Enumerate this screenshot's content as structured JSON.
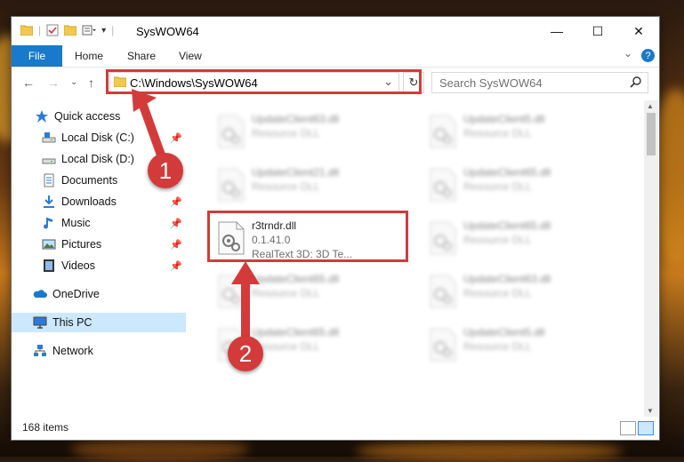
{
  "window": {
    "title": "SysWOW64",
    "buttons": {
      "minimize": "—",
      "maximize": "☐",
      "close": "✕"
    }
  },
  "ribbon": {
    "tabs": [
      "File",
      "Home",
      "Share",
      "View"
    ],
    "expand_glyph": "⌄",
    "help_glyph": "?"
  },
  "navigation": {
    "back": "←",
    "forward": "→",
    "recent": "⌄",
    "up": "↑"
  },
  "address": {
    "path": "C:\\Windows\\SysWOW64",
    "dropdown_glyph": "⌄",
    "refresh_glyph": "↻"
  },
  "search": {
    "placeholder": "Search SysWOW64"
  },
  "sidebar": {
    "items": [
      {
        "label": "Quick access",
        "icon": "star-icon",
        "pinned": false
      },
      {
        "label": "Local Disk (C:)",
        "icon": "drive-icon",
        "pinned": true
      },
      {
        "label": "Local Disk (D:)",
        "icon": "drive-icon",
        "pinned": false
      },
      {
        "label": "Documents",
        "icon": "documents-icon",
        "pinned": true
      },
      {
        "label": "Downloads",
        "icon": "downloads-icon",
        "pinned": true
      },
      {
        "label": "Music",
        "icon": "music-icon",
        "pinned": true
      },
      {
        "label": "Pictures",
        "icon": "pictures-icon",
        "pinned": true
      },
      {
        "label": "Videos",
        "icon": "videos-icon",
        "pinned": true
      },
      {
        "label": "OneDrive",
        "icon": "onedrive-icon",
        "pinned": false
      },
      {
        "label": "This PC",
        "icon": "pc-icon",
        "pinned": false
      },
      {
        "label": "Network",
        "icon": "network-icon",
        "pinned": false
      }
    ],
    "pin_glyph": "📌"
  },
  "files": [
    {
      "name": "UpdateClient63.dll",
      "type": "Resource DLL",
      "blurred": true
    },
    {
      "name": "UpdateClient5.dll",
      "type": "Resource DLL",
      "blurred": true
    },
    {
      "name": "UpdateClient21.dll",
      "type": "Resource DLL",
      "blurred": true
    },
    {
      "name": "UpdateClient65.dll",
      "type": "Resource DLL",
      "blurred": true
    },
    {
      "name": "r3trndr.dll",
      "version": "0.1.41.0",
      "description": "RealText 3D:  3D Te...",
      "blurred": false
    },
    {
      "name": "UpdateClient65.dll",
      "type": "Resource DLL",
      "blurred": true
    },
    {
      "name": "UpdateClient65.dll",
      "type": "Resource DLL",
      "blurred": true
    },
    {
      "name": "UpdateClient63.dll",
      "type": "Resource DLL",
      "blurred": true
    },
    {
      "name": "UpdateClient65.dll",
      "type": "Resource DLL",
      "blurred": true
    },
    {
      "name": "UpdateClient5.dll",
      "type": "Resource DLL",
      "blurred": true
    }
  ],
  "status": {
    "item_count": "168 items"
  },
  "annotations": {
    "callout_1": "1",
    "callout_2": "2",
    "color": "#d33b3b"
  },
  "colors": {
    "accent": "#1979ca",
    "selected": "#cce8ff",
    "highlight": "#d33b3b"
  }
}
